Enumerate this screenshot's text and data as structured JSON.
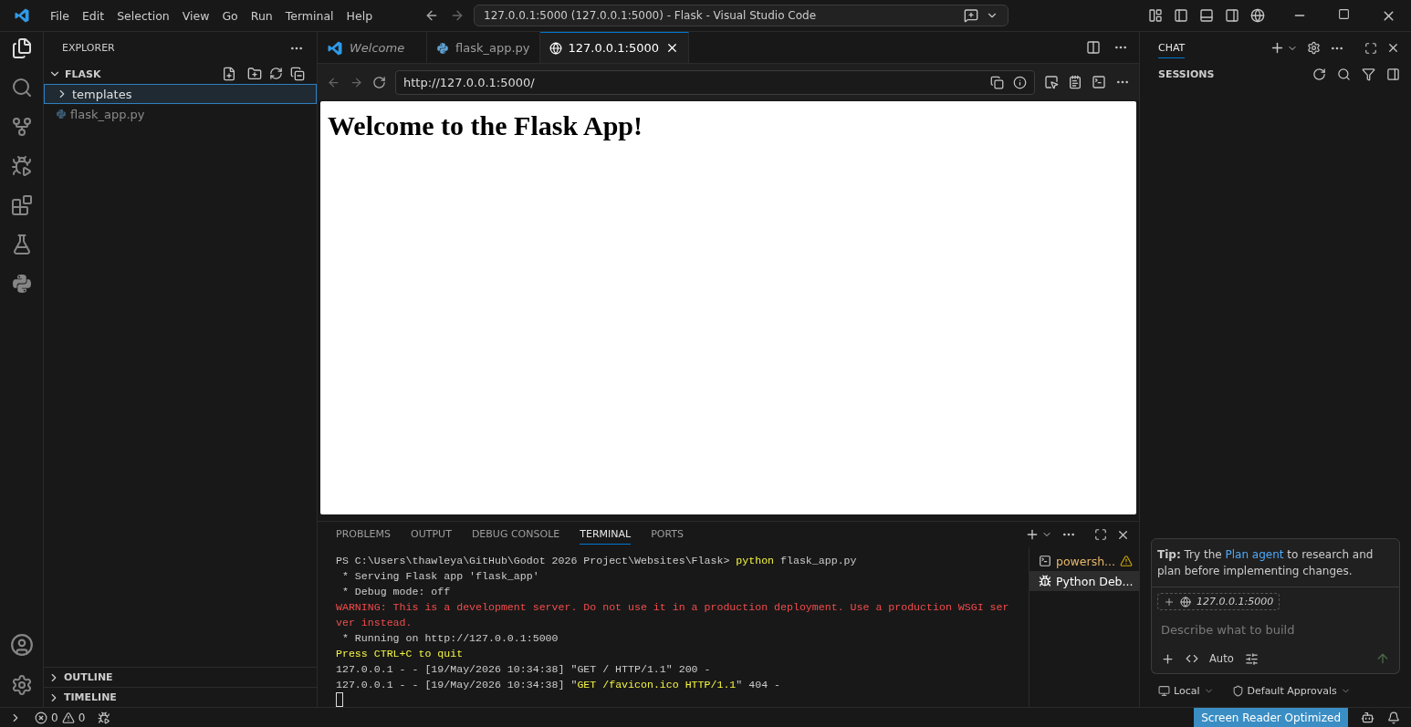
{
  "title_bar": {
    "menu": [
      "File",
      "Edit",
      "Selection",
      "View",
      "Go",
      "Run",
      "Terminal",
      "Help"
    ],
    "command_center": "127.0.0.1:5000 (127.0.0.1:5000) - Flask - Visual Studio Code"
  },
  "explorer": {
    "title": "EXPLORER",
    "folder": {
      "name": "FLASK",
      "expanded": true
    },
    "items": [
      {
        "name": "templates",
        "kind": "folder",
        "expanded": false,
        "selected": true
      },
      {
        "name": "flask_app.py",
        "kind": "python",
        "selected": false
      }
    ],
    "sections": [
      {
        "name": "OUTLINE",
        "expanded": false
      },
      {
        "name": "TIMELINE",
        "expanded": false
      }
    ]
  },
  "editor_tabs": [
    {
      "label": "Welcome",
      "kind": "welcome",
      "selected": false
    },
    {
      "label": "flask_app.py",
      "kind": "python",
      "selected": false
    },
    {
      "label": "127.0.0.1:5000",
      "kind": "browser",
      "selected": true
    }
  ],
  "browser": {
    "url": "http://127.0.0.1:5000/",
    "heading": "Welcome to the Flask App!"
  },
  "panel": {
    "tabs": [
      {
        "label": "PROBLEMS",
        "selected": false
      },
      {
        "label": "OUTPUT",
        "selected": false
      },
      {
        "label": "DEBUG CONSOLE",
        "selected": false
      },
      {
        "label": "TERMINAL",
        "selected": true
      },
      {
        "label": "PORTS",
        "selected": false
      }
    ],
    "terminal_lines": [
      [
        {
          "text": "PS C:\\Users\\thawleya\\GitHub\\Godot 2026 Project\\Websites\\Flask> ",
          "kind": "plain"
        },
        {
          "text": "python",
          "kind": "yellow"
        },
        {
          "text": " flask_app.py",
          "kind": "plain"
        }
      ],
      [
        {
          "text": " * Serving Flask app 'flask_app'",
          "kind": "plain"
        }
      ],
      [
        {
          "text": " * Debug mode: off",
          "kind": "plain"
        }
      ],
      [
        {
          "text": "WARNING: This is a development server. Do not use it in a production deployment. Use a production WSGI ser",
          "kind": "red"
        }
      ],
      [
        {
          "text": "ver instead.",
          "kind": "red"
        }
      ],
      [
        {
          "text": " * Running on http://127.0.0.1:5000",
          "kind": "plain"
        }
      ],
      [
        {
          "text": "Press CTRL+C to quit",
          "kind": "yellow"
        }
      ],
      [
        {
          "text": "127.0.0.1 - - [19/May/2026 10:34:38] \"GET / HTTP/1.1\" 200 -",
          "kind": "plain"
        }
      ],
      [
        {
          "text": "127.0.0.1 - - [19/May/2026 10:34:38] \"",
          "kind": "plain"
        },
        {
          "text": "GET /favicon.ico HTTP/1.1",
          "kind": "yellow"
        },
        {
          "text": "\" 404 -",
          "kind": "plain"
        }
      ]
    ],
    "terminals": [
      {
        "label": "powersh...",
        "kind": "shell",
        "warning": true,
        "selected": false
      },
      {
        "label": "Python Deb...",
        "kind": "debug",
        "warning": false,
        "selected": true
      }
    ]
  },
  "chat": {
    "title": "CHAT",
    "sessions": "SESSIONS",
    "tip": {
      "label": "Tip:",
      "before": "Try the ",
      "link": "Plan agent",
      "after": " to research and plan before implementing changes."
    },
    "context": "127.0.0.1:5000",
    "placeholder": "Describe what to build",
    "mode": "Auto",
    "location": "Local",
    "approvals": "Default Approvals"
  },
  "status_bar": {
    "errors": "0",
    "warnings": "0",
    "screen_reader": "Screen Reader Optimized"
  }
}
